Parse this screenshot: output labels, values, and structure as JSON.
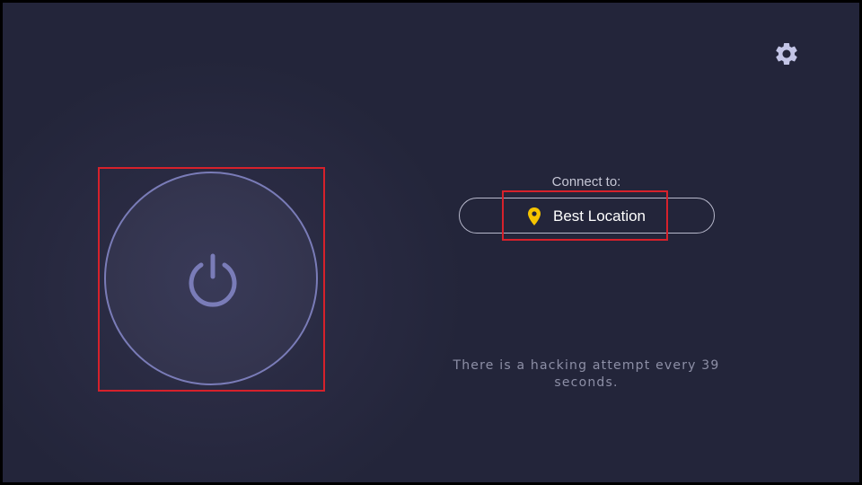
{
  "colors": {
    "background": "#23253a",
    "power_ring": "#7a7cb8",
    "pin_accent": "#f5c400",
    "highlight_box": "#d6212b",
    "tagline_text": "#8d8fa6"
  },
  "header": {
    "settings_icon": "gear-icon"
  },
  "power": {
    "icon": "power-icon"
  },
  "connect": {
    "label": "Connect to:",
    "location": {
      "icon": "location-pin-icon",
      "name": "Best Location"
    }
  },
  "footer": {
    "tagline": "There is a hacking attempt every 39 seconds."
  }
}
